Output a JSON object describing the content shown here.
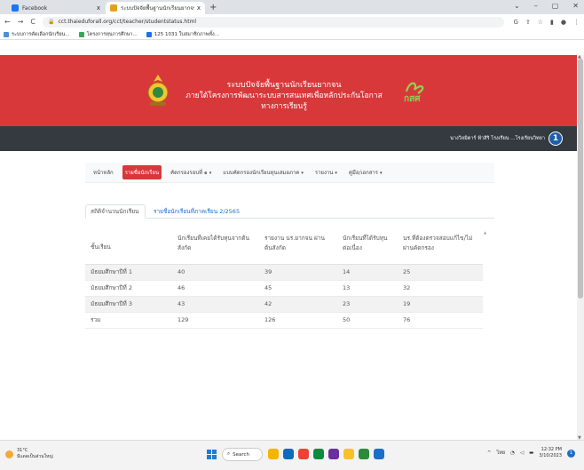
{
  "browser": {
    "tabs": [
      {
        "title": "Facebook",
        "close": "x",
        "favicon_color": "#1877f2"
      },
      {
        "title": "ระบบปัจจัยพื้นฐานนักเรียนยากจน",
        "close": "x",
        "favicon_color": "#e2a21f"
      }
    ],
    "new_tab": "+",
    "window_controls": [
      "⌄",
      "–",
      "▢",
      "✕"
    ],
    "url": "cct.thaieduforall.org/cct/teacher/studentstatus.html",
    "bookmarks": [
      {
        "label": "ระบบการคัดเลือกนักเรียน...",
        "icon_color": "#4a90d9"
      },
      {
        "label": "โครงการทุนการศึกษา...",
        "icon_color": "#34a853"
      },
      {
        "label": "125 1031 ใบสมาชิกภาพทั้ง...",
        "icon_color": "#1a73e8"
      }
    ]
  },
  "site": {
    "title": "ระบบปัจจัยพื้นฐานนักเรียนยากจน",
    "subtitle": "ภายใต้โครงการพัฒนาระบบสารสนเทศเพื่อหลักประกันโอกาสทางการเรียนรู้",
    "partner_logo": "กสศ",
    "user_name": "นางวิลมิตาร์ ฟ้าสิริ โรงเรียน ...โรงเรียนวิทยา",
    "avatar_letter": "1",
    "brand_red": "#d9383b",
    "header_dark": "#343a40"
  },
  "menu": [
    {
      "label": "หน้าหลัก",
      "active": false,
      "dropdown": false
    },
    {
      "label": "รายชื่อนักเรียน",
      "active": true,
      "dropdown": false
    },
    {
      "label": "คัดกรองรอบที่ ๑",
      "active": false,
      "dropdown": true
    },
    {
      "label": "แบบคัดกรองนักเรียนทุนเสมอภาค",
      "active": false,
      "dropdown": true
    },
    {
      "label": "รายงาน",
      "active": false,
      "dropdown": true
    },
    {
      "label": "คู่มือ/เอกสาร",
      "active": false,
      "dropdown": true
    }
  ],
  "content_tabs": [
    {
      "label": "สถิติจำนวนนักเรียน",
      "active": true
    },
    {
      "label": "รายชื่อนักเรียนที่ภาคเรียน 2/2565",
      "active": false
    }
  ],
  "table": {
    "headers": [
      "ชั้นเรียน",
      "นักเรียนที่เคยได้รับทุนจากต้นสังกัด",
      "รายงาน นร.ยากจน ผ่านต้นสังกัด",
      "นักเรียนที่ได้รับทุนต่อเนื่อง",
      "นร.ที่ต้องตรวจสอบแก้ไข/ไม่ผ่านคัดกรอง"
    ],
    "rows": [
      [
        "มัธยมศึกษาปีที่ 1",
        "40",
        "39",
        "14",
        "25"
      ],
      [
        "มัธยมศึกษาปีที่ 2",
        "46",
        "45",
        "13",
        "32"
      ],
      [
        "มัธยมศึกษาปีที่ 3",
        "43",
        "42",
        "23",
        "19"
      ],
      [
        "รวม",
        "129",
        "126",
        "50",
        "76"
      ]
    ]
  },
  "taskbar": {
    "weather_temp": "31°C",
    "weather_desc": "มีแดดเป็นส่วนใหญ่",
    "search_label": "Search",
    "apps": [
      "#f4b400",
      "#0f6cbd",
      "#ea4335",
      "#0e8a3f",
      "#6b2fa0",
      "#f7c12b",
      "#2c8c3a",
      "#1a6fc9"
    ],
    "tray_lang": "ไทย",
    "time": "12:32 PM",
    "date": "3/10/2023",
    "notifications": "1"
  }
}
